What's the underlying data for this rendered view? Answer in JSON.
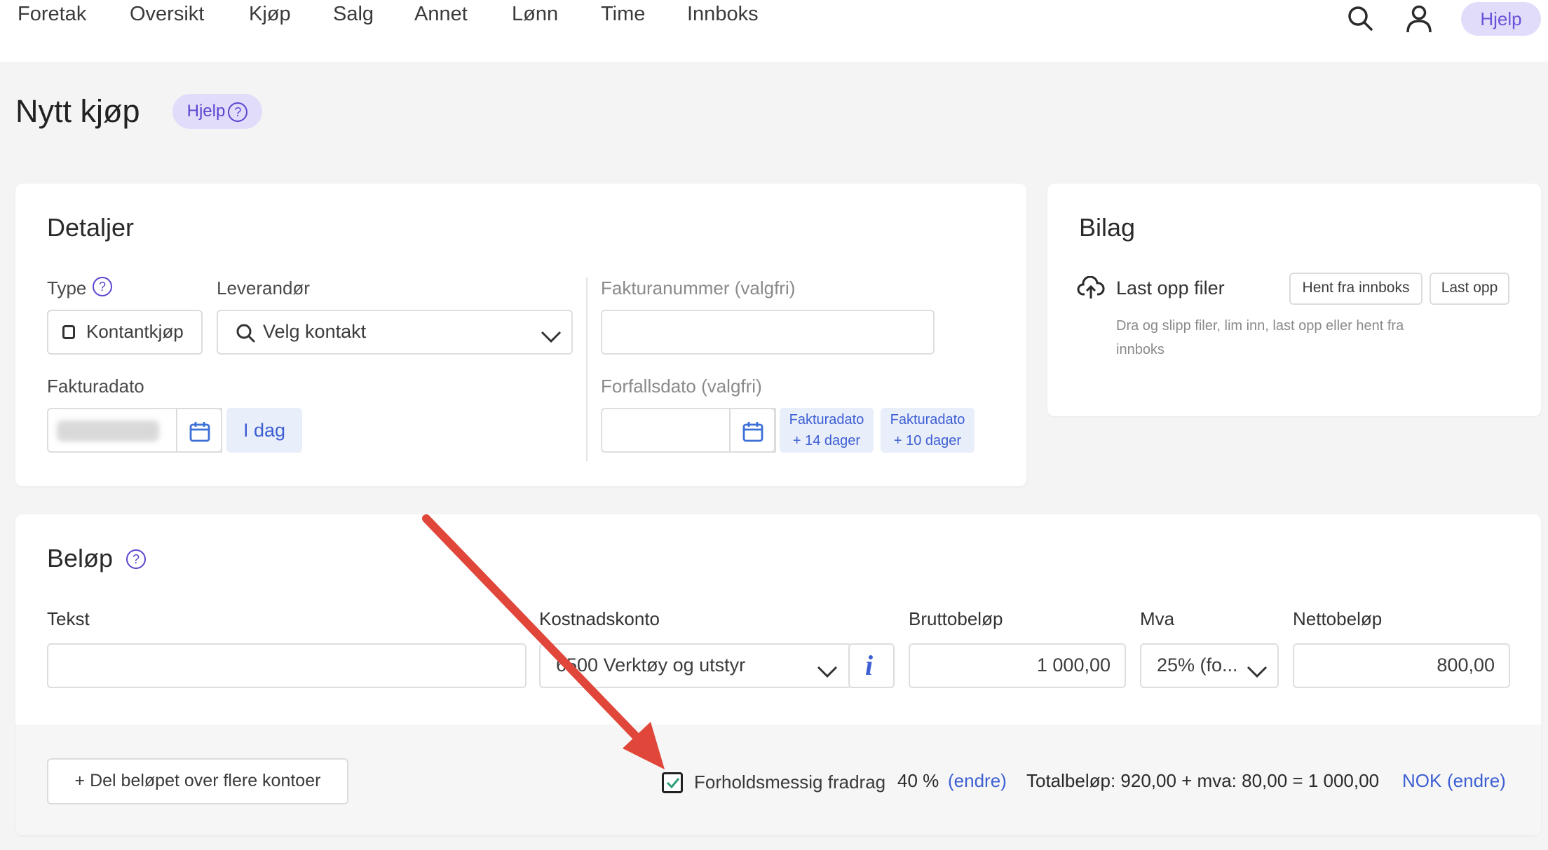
{
  "nav": {
    "items": [
      "Foretak",
      "Oversikt",
      "Kjøp",
      "Salg",
      "Annet",
      "Lønn",
      "Time",
      "Innboks"
    ],
    "search_icon": "search-icon",
    "user_icon": "user-icon",
    "help_label": "Hjelp"
  },
  "page": {
    "title": "Nytt kjøp",
    "help_label": "Hjelp"
  },
  "details": {
    "title": "Detaljer",
    "type_label": "Type",
    "type_value": "Kontantkjøp",
    "supplier_label": "Leverandør",
    "supplier_placeholder": "Velg kontakt",
    "invoice_number_label": "Fakturanummer (valgfri)",
    "invoice_date_label": "Fakturadato",
    "today_label": "I dag",
    "due_date_label": "Forfallsdato (valgfri)",
    "quick_14_line1": "Fakturadato",
    "quick_14_line2": "+ 14 dager",
    "quick_10_line1": "Fakturadato",
    "quick_10_line2": "+ 10 dager"
  },
  "attachments": {
    "title": "Bilag",
    "upload_label": "Last opp filer",
    "fetch_inbox_label": "Hent fra innboks",
    "upload_button": "Last opp",
    "hint_line1": "Dra og slipp filer, lim inn, last opp eller hent fra",
    "hint_line2": "innboks"
  },
  "amount": {
    "title": "Beløp",
    "text_label": "Tekst",
    "account_label": "Kostnadskonto",
    "account_value": "6500 Verktøy og utstyr",
    "gross_label": "Bruttobeløp",
    "gross_value": "1 000,00",
    "vat_label": "Mva",
    "vat_value": "25% (fo...",
    "net_label": "Nettobeløp",
    "net_value": "800,00",
    "split_button": "+ Del beløpet over flere kontoer",
    "proportional_label": "Forholdsmessig fradrag",
    "proportional_pct": "40 %",
    "edit_label": "(endre)",
    "total_text": "Totalbeløp: 920,00 + mva: 80,00 = 1 000,00",
    "currency": "NOK",
    "currency_edit": "(endre)"
  },
  "annotation": {
    "arrow_color": "#e0463a"
  }
}
